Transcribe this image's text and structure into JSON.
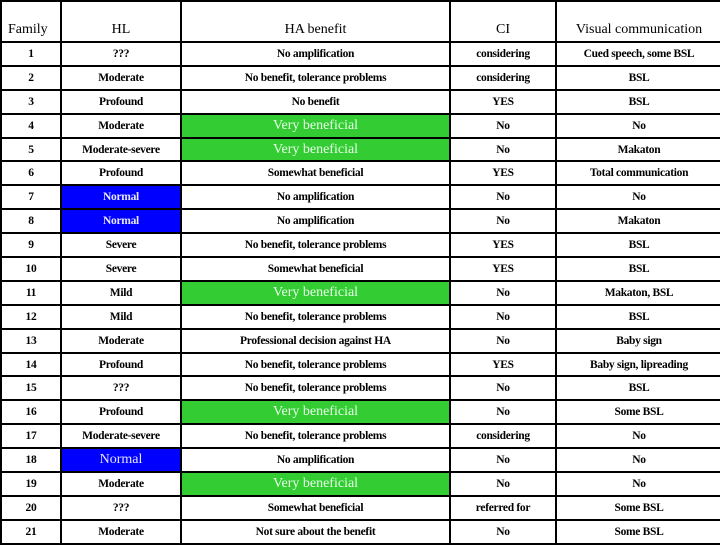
{
  "table": {
    "headers": [
      "Family",
      "HL",
      "HA benefit",
      "CI",
      "Visual communication"
    ],
    "highlight_colors": {
      "very_beneficial": "#33cc33",
      "normal_hl": "#0000ff"
    },
    "rows": [
      {
        "family": "1",
        "hl": "???",
        "ha": "No amplification",
        "ci": "considering",
        "visual": "Cued speech, some BSL"
      },
      {
        "family": "2",
        "hl": "Moderate",
        "ha": "No benefit, tolerance problems",
        "ci": "considering",
        "visual": "BSL"
      },
      {
        "family": "3",
        "hl": "Profound",
        "ha": "No benefit",
        "ci": "YES",
        "visual": "BSL"
      },
      {
        "family": "4",
        "hl": "Moderate",
        "ha": "Very beneficial",
        "ci": "No",
        "visual": "No"
      },
      {
        "family": "5",
        "hl": "Moderate-severe",
        "ha": "Very beneficial",
        "ci": "No",
        "visual": "Makaton"
      },
      {
        "family": "6",
        "hl": "Profound",
        "ha": "Somewhat beneficial",
        "ci": "YES",
        "visual": "Total communication"
      },
      {
        "family": "7",
        "hl": "Normal",
        "ha": "No amplification",
        "ci": "No",
        "visual": "No"
      },
      {
        "family": "8",
        "hl": "Normal",
        "ha": "No amplification",
        "ci": "No",
        "visual": "Makaton"
      },
      {
        "family": "9",
        "hl": "Severe",
        "ha": "No benefit, tolerance problems",
        "ci": "YES",
        "visual": "BSL"
      },
      {
        "family": "10",
        "hl": "Severe",
        "ha": "Somewhat beneficial",
        "ci": "YES",
        "visual": "BSL"
      },
      {
        "family": "11",
        "hl": "Mild",
        "ha": "Very beneficial",
        "ci": "No",
        "visual": "Makaton, BSL"
      },
      {
        "family": "12",
        "hl": "Mild",
        "ha": "No benefit, tolerance problems",
        "ci": "No",
        "visual": "BSL"
      },
      {
        "family": "13",
        "hl": "Moderate",
        "ha": "Professional decision against HA",
        "ci": "No",
        "visual": "Baby sign"
      },
      {
        "family": "14",
        "hl": "Profound",
        "ha": "No benefit, tolerance problems",
        "ci": "YES",
        "visual": "Baby sign, lipreading"
      },
      {
        "family": "15",
        "hl": "???",
        "ha": "No benefit, tolerance problems",
        "ci": "No",
        "visual": "BSL"
      },
      {
        "family": "16",
        "hl": "Profound",
        "ha": "Very beneficial",
        "ci": "No",
        "visual": "Some BSL"
      },
      {
        "family": "17",
        "hl": "Moderate-severe",
        "ha": "No benefit, tolerance problems",
        "ci": "considering",
        "visual": "No"
      },
      {
        "family": "18",
        "hl": "Normal",
        "ha": "No amplification",
        "ci": "No",
        "visual": "No"
      },
      {
        "family": "19",
        "hl": "Moderate",
        "ha": "Very beneficial",
        "ci": "No",
        "visual": "No"
      },
      {
        "family": "20",
        "hl": "???",
        "ha": "Somewhat beneficial",
        "ci": "referred for",
        "visual": "Some BSL"
      },
      {
        "family": "21",
        "hl": "Moderate",
        "ha": "Not sure about the benefit",
        "ci": "No",
        "visual": "Some BSL"
      }
    ]
  }
}
